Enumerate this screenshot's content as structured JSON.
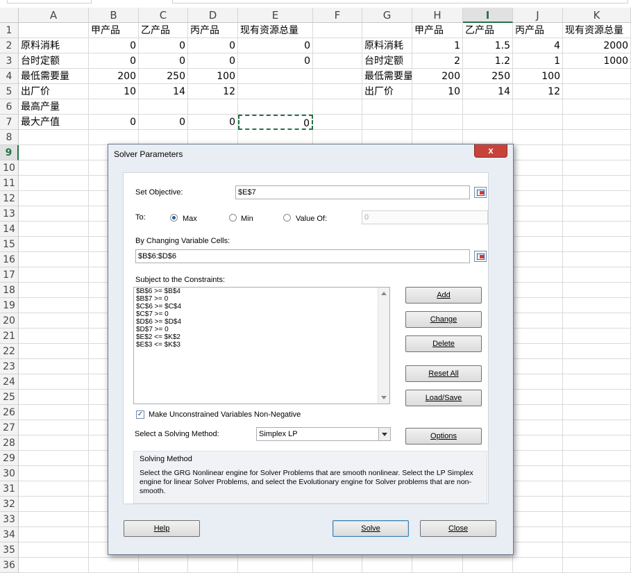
{
  "columns": [
    "A",
    "B",
    "C",
    "D",
    "E",
    "F",
    "G",
    "H",
    "I",
    "J",
    "K"
  ],
  "rows": [
    1,
    2,
    3,
    4,
    5,
    6,
    7,
    8,
    9,
    10,
    11,
    12,
    13,
    14,
    15,
    16,
    17,
    18,
    19,
    20,
    21,
    22,
    23,
    24,
    25,
    26,
    27,
    28,
    29,
    30,
    31,
    32,
    33,
    34,
    35,
    36
  ],
  "sheet": {
    "r1": {
      "B": "甲产品",
      "C": "乙产品",
      "D": "丙产品",
      "E": "现有资源总量",
      "H": "甲产品",
      "I": "乙产品",
      "J": "丙产品",
      "K": "现有资源总量"
    },
    "r2": {
      "A": "原料消耗",
      "B": "0",
      "C": "0",
      "D": "0",
      "E": "0",
      "G": "原料消耗",
      "H": "1",
      "I": "1.5",
      "J": "4",
      "K": "2000"
    },
    "r3": {
      "A": "台时定额",
      "B": "0",
      "C": "0",
      "D": "0",
      "E": "0",
      "G": "台时定额",
      "H": "2",
      "I": "1.2",
      "J": "1",
      "K": "1000"
    },
    "r4": {
      "A": "最低需要量",
      "B": "200",
      "C": "250",
      "D": "100",
      "G": "最低需要量",
      "H": "200",
      "I": "250",
      "J": "100"
    },
    "r5": {
      "A": "出厂价",
      "B": "10",
      "C": "14",
      "D": "12",
      "G": "出厂价",
      "H": "10",
      "I": "14",
      "J": "12"
    },
    "r6": {
      "A": "最高产量"
    },
    "r7": {
      "A": "最大产值",
      "B": "0",
      "C": "0",
      "D": "0",
      "E": "0"
    }
  },
  "dialog": {
    "title": "Solver Parameters",
    "close_glyph": "x",
    "set_objective_label": "Set Objective:",
    "objective_value": "$E$7",
    "to_label": "To:",
    "max_label": "Max",
    "min_label": "Min",
    "value_of_label": "Value Of:",
    "value_of_value": "0",
    "selected_goal": "Max",
    "changing_label": "By Changing Variable Cells:",
    "changing_value": "$B$6:$D$6",
    "constraints_label": "Subject to the Constraints:",
    "constraints": [
      "$B$6 >= $B$4",
      "$B$7 >= 0",
      "$C$6 >= $C$4",
      "$C$7 >= 0",
      "$D$6 >= $D$4",
      "$D$7 >= 0",
      "$E$2 <= $K$2",
      "$E$3 <= $K$3"
    ],
    "buttons": {
      "add": "Add",
      "change": "Change",
      "delete": "Delete",
      "reset_all": "Reset All",
      "load_save": "Load/Save",
      "options": "Options",
      "help": "Help",
      "solve": "Solve",
      "close": "Close"
    },
    "nonnegative_label": "Make Unconstrained Variables Non-Negative",
    "nonnegative_checked": true,
    "method_label": "Select a Solving Method:",
    "method_value": "Simplex LP",
    "solving_method_title": "Solving Method",
    "solving_method_desc": "Select the GRG Nonlinear engine for Solver Problems that are smooth nonlinear. Select the LP Simplex engine for linear Solver Problems, and select the Evolutionary engine for Solver problems that are non-smooth."
  }
}
